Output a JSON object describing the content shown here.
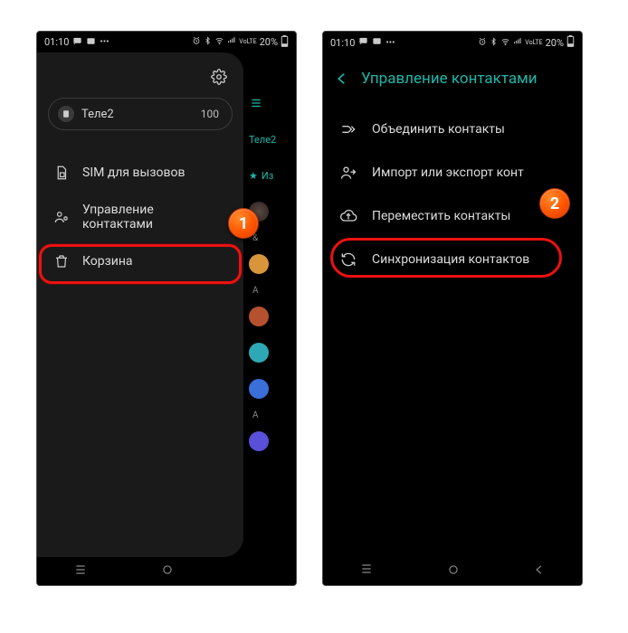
{
  "status": {
    "time": "01:10",
    "battery": "20%",
    "network_label": "VoLTE"
  },
  "left": {
    "sim": {
      "name": "Теле2",
      "count": "100"
    },
    "items": {
      "sim_calls": "SIM для вызовов",
      "manage_contacts": "Управление контактами",
      "trash": "Корзина"
    },
    "strip": {
      "carrier": "Теле2",
      "favorites_short": "Из",
      "amp": "&",
      "letter_a": "А",
      "letter_a2": "A"
    }
  },
  "right": {
    "title": "Управление контактами",
    "items": {
      "merge": "Объединить контакты",
      "import_export": "Импорт или экспорт конт",
      "move": "Переместить контакты",
      "sync": "Синхронизация контактов"
    }
  },
  "callouts": {
    "one": "1",
    "two": "2"
  }
}
